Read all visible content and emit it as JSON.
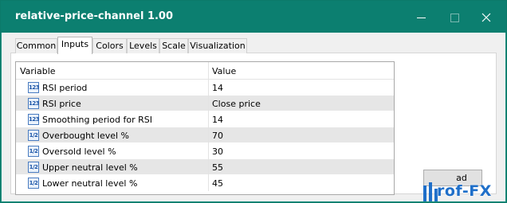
{
  "window": {
    "title": "relative-price-channel 1.00",
    "controls": [
      "minimize-icon",
      "maximize-icon",
      "close-icon"
    ]
  },
  "tabs": [
    "Common",
    "Inputs",
    "Colors",
    "Levels",
    "Scale",
    "Visualization"
  ],
  "active_tab": "Inputs",
  "grid": {
    "columns": [
      "Variable",
      "Value"
    ],
    "rows": [
      {
        "icon": "integer-icon",
        "icon_text": "123",
        "name": "RSI period",
        "value": "14"
      },
      {
        "icon": "integer-icon",
        "icon_text": "123",
        "name": "RSI price",
        "value": "Close price"
      },
      {
        "icon": "integer-icon",
        "icon_text": "123",
        "name": "Smoothing period for RSI",
        "value": "14"
      },
      {
        "icon": "double-icon",
        "icon_text": "1/2",
        "name": "Overbought level %",
        "value": "70"
      },
      {
        "icon": "double-icon",
        "icon_text": "1/2",
        "name": "Oversold level %",
        "value": "30"
      },
      {
        "icon": "double-icon",
        "icon_text": "1/2",
        "name": "Upper neutral level %",
        "value": "55"
      },
      {
        "icon": "double-icon",
        "icon_text": "1/2",
        "name": "Lower neutral level %",
        "value": "45"
      }
    ]
  },
  "button": {
    "visible_label": "ad"
  },
  "watermark": {
    "text": "rof-FX"
  },
  "colors": {
    "titlebar": "#0c7f70",
    "row_alt": "#e6e6e6",
    "watermark": "#1f6fc9"
  }
}
